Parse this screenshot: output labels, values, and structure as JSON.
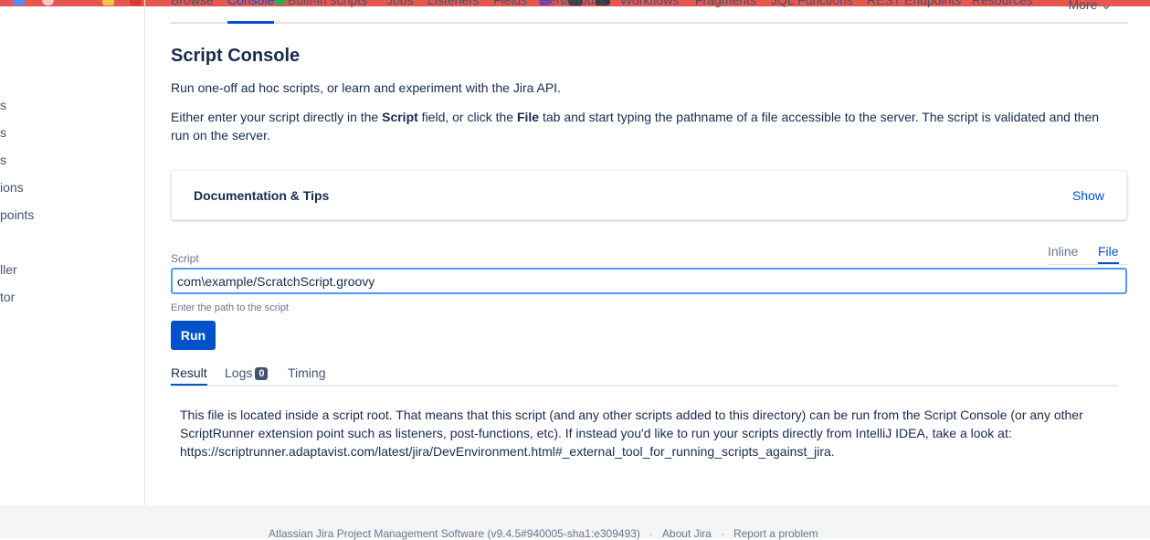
{
  "sidebar": {
    "items": [
      "s",
      "s",
      "s",
      "ions",
      "points",
      "",
      "ller",
      "tor"
    ]
  },
  "nav": {
    "tabs": [
      "Browse",
      "Console",
      "Built-in scripts",
      "Jobs",
      "Listeners",
      "Fields",
      "Behaviours",
      "Workflows",
      "Fragments",
      "JQL Functions",
      "REST Endpoints",
      "Resources"
    ],
    "more": "More"
  },
  "page": {
    "title": "Script Console",
    "intro": "Run one-off ad hoc scripts, or learn and experiment with the Jira API.",
    "desc_pre": "Either enter your script directly in the ",
    "desc_script": "Script",
    "desc_mid": " field, or click the ",
    "desc_file": "File",
    "desc_post": " tab and start typing the pathname of a file accessible to the server. The script is validated and then run on the server."
  },
  "docs": {
    "title": "Documentation & Tips",
    "show": "Show"
  },
  "script": {
    "label": "Script",
    "mode_inline": "Inline",
    "mode_file": "File",
    "value": "com\\example/ScratchScript.groovy",
    "helper": "Enter the path to the script",
    "run": "Run"
  },
  "results": {
    "tab_result": "Result",
    "tab_logs": "Logs",
    "logs_count": "0",
    "tab_timing": "Timing",
    "text": "This file is located inside a script root. That means that this script (and any other scripts added to this directory) can be run from the Script Console (or any other ScriptRunner extension point such as listeners, post-functions, etc). If instead you'd like to run your scripts directly from IntelliJ IDEA, take a look at: https://scriptrunner.adaptavist.com/latest/jira/DevEnvironment.html#_external_tool_for_running_scripts_against_jira."
  },
  "footer": {
    "version": "Atlassian Jira Project Management Software (v9.4.5#940005-sha1:e309493)",
    "sep": "·",
    "about": "About Jira",
    "report": "Report a problem"
  },
  "colors": {
    "accent": "#0052cc",
    "strip": "#e8574f"
  }
}
